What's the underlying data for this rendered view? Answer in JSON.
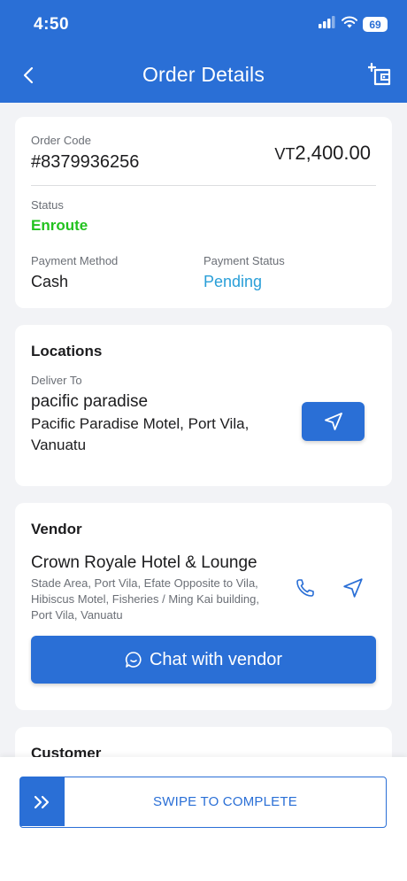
{
  "status_bar": {
    "time": "4:50",
    "battery": "69"
  },
  "header": {
    "title": "Order Details"
  },
  "order": {
    "code_label": "Order Code",
    "code": "#8379936256",
    "currency": "VT",
    "amount": "2,400.00",
    "status_label": "Status",
    "status": "Enroute",
    "payment_method_label": "Payment Method",
    "payment_method": "Cash",
    "payment_status_label": "Payment Status",
    "payment_status": "Pending"
  },
  "locations": {
    "title": "Locations",
    "deliver_to_label": "Deliver To",
    "name": "pacific paradise",
    "address_line1": "Pacific Paradise Motel, Port Vila,",
    "address_line2": "Vanuatu"
  },
  "vendor": {
    "title": "Vendor",
    "name": "Crown Royale Hotel & Lounge",
    "address_line1": "Stade Area, Port Vila, Efate Opposite to Vila,",
    "address_line2": "Hibiscus Motel, Fisheries / Ming Kai building,",
    "address_line3": "Port Vila, Vanuatu",
    "chat_label": "Chat with vendor"
  },
  "customer": {
    "title": "Customer"
  },
  "swipe": {
    "label": "SWIPE TO COMPLETE"
  },
  "colors": {
    "primary": "#2a6fd6",
    "status_green": "#22c21f",
    "pending_blue": "#2a9fd8"
  },
  "icons": [
    "back-arrow-icon",
    "add-wallet-icon",
    "navigate-icon",
    "phone-icon",
    "chat-bubble-icon",
    "double-chevron-right-icon",
    "signal-icon",
    "wifi-icon",
    "battery-icon"
  ]
}
